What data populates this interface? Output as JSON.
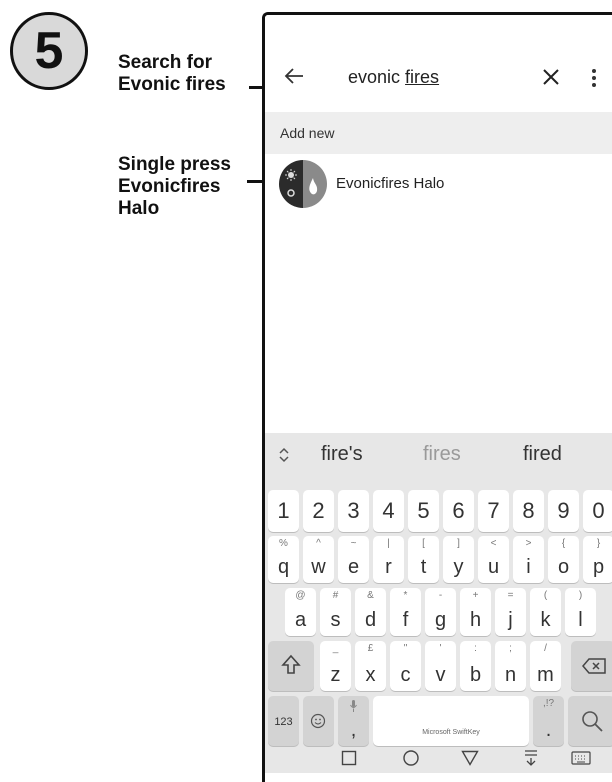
{
  "step": {
    "number": "5"
  },
  "callouts": [
    {
      "text": "Search for\nEvonic fires"
    },
    {
      "text": "Single press\nEvonicfires\nHalo"
    }
  ],
  "search": {
    "prefix": "evonic ",
    "underlined": "fires"
  },
  "add_new": {
    "label": "Add new"
  },
  "result": {
    "label": "Evonicfires Halo"
  },
  "keyboard": {
    "suggestions": [
      "fire's",
      "fires",
      "fired"
    ],
    "number_row": [
      "1",
      "2",
      "3",
      "4",
      "5",
      "6",
      "7",
      "8",
      "9",
      "0"
    ],
    "row1": [
      {
        "main": "q",
        "sub": "%"
      },
      {
        "main": "w",
        "sub": "^"
      },
      {
        "main": "e",
        "sub": "~"
      },
      {
        "main": "r",
        "sub": "|"
      },
      {
        "main": "t",
        "sub": "["
      },
      {
        "main": "y",
        "sub": "]"
      },
      {
        "main": "u",
        "sub": "<"
      },
      {
        "main": "i",
        "sub": ">"
      },
      {
        "main": "o",
        "sub": "{"
      },
      {
        "main": "p",
        "sub": "}"
      }
    ],
    "row2": [
      {
        "main": "a",
        "sub": "@"
      },
      {
        "main": "s",
        "sub": "#"
      },
      {
        "main": "d",
        "sub": "&"
      },
      {
        "main": "f",
        "sub": "*"
      },
      {
        "main": "g",
        "sub": "-"
      },
      {
        "main": "h",
        "sub": "+"
      },
      {
        "main": "j",
        "sub": "="
      },
      {
        "main": "k",
        "sub": "("
      },
      {
        "main": "l",
        "sub": ")"
      }
    ],
    "row3": [
      {
        "main": "z",
        "sub": "_"
      },
      {
        "main": "x",
        "sub": "£"
      },
      {
        "main": "c",
        "sub": "\""
      },
      {
        "main": "v",
        "sub": "'"
      },
      {
        "main": "b",
        "sub": ":"
      },
      {
        "main": "n",
        "sub": ";"
      },
      {
        "main": "m",
        "sub": "/"
      }
    ],
    "bottom": {
      "symbols_label": "123",
      "comma": ",",
      "space_label": "Microsoft SwiftKey",
      "period": ".",
      "period_sub": ",!?"
    }
  },
  "icons": [
    "back-arrow-icon",
    "close-icon",
    "more-vert-icon",
    "evonic-flame-icon",
    "chevron-icon",
    "shift-icon",
    "backspace-icon",
    "emoji-icon",
    "mic-icon",
    "search-icon",
    "recents-icon",
    "home-icon",
    "back-icon",
    "keyboard-hide-icon",
    "keyboard-icon"
  ]
}
